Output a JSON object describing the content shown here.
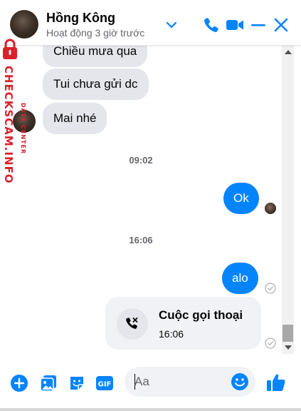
{
  "header": {
    "contact_name": "Hồng Kông",
    "status": "Hoạt động 3 giờ trước",
    "icons": [
      "chevron-down-icon",
      "phone-icon",
      "video-camera-icon",
      "minimize-icon",
      "close-icon"
    ]
  },
  "watermark": {
    "brand": "CHECKSCAM.INFO",
    "tagline": "DATA CENTER"
  },
  "messages": {
    "incoming": [
      "Chiều mưa qua",
      "Tui chưa gửi dc",
      "Mai nhé"
    ],
    "time_1": "09:02",
    "outgoing_1": "Ok",
    "time_2": "16:06",
    "outgoing_2": "alo",
    "call": {
      "title": "Cuộc gọi thoại",
      "time": "16:06"
    }
  },
  "composer": {
    "placeholder": "Aa",
    "icons": [
      "add-icon",
      "photo-icon",
      "sticker-icon",
      "gif-icon",
      "emoji-icon",
      "thumbs-up-icon"
    ],
    "gif_label": "GIF"
  },
  "colors": {
    "accent": "#0084ff",
    "incoming_bubble": "#e4e6eb",
    "watermark_red": "#d9212c"
  }
}
